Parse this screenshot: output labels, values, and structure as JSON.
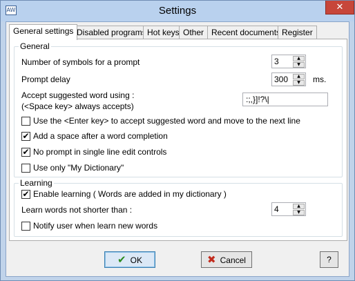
{
  "window": {
    "title": "Settings",
    "icon_text": "AW",
    "close_glyph": "✕"
  },
  "tabs": [
    {
      "label": "General settings"
    },
    {
      "label": "Disabled programs"
    },
    {
      "label": "Hot keys"
    },
    {
      "label": "Other"
    },
    {
      "label": "Recent documents"
    },
    {
      "label": "Register"
    }
  ],
  "general": {
    "legend": "General",
    "symbols_label": "Number of symbols for a prompt",
    "symbols_value": "3",
    "delay_label": "Prompt delay",
    "delay_value": "300",
    "delay_unit": "ms.",
    "accept_label_1": "Accept suggested word using :",
    "accept_label_2": "(<Space key> always accepts)",
    "accept_value": ":;,}]!?\\|",
    "checkboxes": [
      {
        "label": "Use the <Enter key> to accept suggested word and move to the next line",
        "checked": false,
        "mark": ""
      },
      {
        "label": "Add a space after a word completion",
        "checked": true,
        "mark": "✔"
      },
      {
        "label": "No prompt in single line edit controls",
        "checked": true,
        "mark": "✔"
      },
      {
        "label": "Use only \"My Dictionary\"",
        "checked": false,
        "mark": ""
      }
    ]
  },
  "learning": {
    "legend": "Learning",
    "enable": {
      "label": "Enable learning  ( Words are added in my dictionary )",
      "checked": true,
      "mark": "✔"
    },
    "min_len_label": "Learn words not shorter than :",
    "min_len_value": "4",
    "notify": {
      "label": "Notify user when learn new words",
      "checked": false,
      "mark": ""
    }
  },
  "spinner": {
    "up_glyph": "▲",
    "down_glyph": "▼"
  },
  "buttons": {
    "ok": {
      "label": "OK",
      "icon": "✔"
    },
    "cancel": {
      "label": "Cancel",
      "icon": "✖"
    },
    "help": {
      "label": "?"
    }
  }
}
